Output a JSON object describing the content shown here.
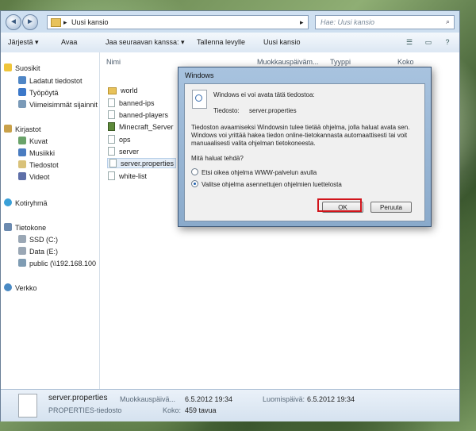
{
  "window": {
    "breadcrumb": [
      "▸",
      "Uusi kansio",
      "▸"
    ],
    "search_placeholder": "Hae: Uusi kansio",
    "toolbar": [
      "Järjestä ▾",
      "Avaa",
      "Jaa seuraavan kanssa: ▾",
      "Tallenna levylle",
      "Uusi kansio"
    ]
  },
  "nav": {
    "favorites_header": "Suosikit",
    "favorites": [
      "Ladatut tiedostot",
      "Työpöytä",
      "Viimeisimmät sijainnit"
    ],
    "libraries_header": "Kirjastot",
    "libraries": [
      "Kuvat",
      "Musiikki",
      "Tiedostot",
      "Videot"
    ],
    "homegroup": "Kotiryhmä",
    "computer_header": "Tietokone",
    "drives": [
      "SSD (C:)",
      "Data (E:)",
      "public (\\\\192.168.100"
    ],
    "network": "Verkko"
  },
  "columns": [
    "Nimi",
    "Muokkauspäiväm...",
    "Tyyppi",
    "Koko"
  ],
  "files": [
    {
      "name": "world",
      "icon": "folder-icon"
    },
    {
      "name": "banned-ips",
      "icon": "file-icon"
    },
    {
      "name": "banned-players",
      "icon": "file-icon"
    },
    {
      "name": "Minecraft_Server",
      "icon": "minecraft-icon"
    },
    {
      "name": "ops",
      "icon": "file-icon"
    },
    {
      "name": "server",
      "icon": "file-icon"
    },
    {
      "name": "server.properties",
      "icon": "file-icon"
    },
    {
      "name": "white-list",
      "icon": "file-icon"
    }
  ],
  "status": {
    "filename": "server.properties",
    "filetype": "PROPERTIES-tiedosto",
    "modified_label": "Muokkauspäivä...",
    "modified_value": "6.5.2012 19:34",
    "created_label": "Luomispäivä:",
    "created_value": "6.5.2012 19:34",
    "size_label": "Koko:",
    "size_value": "459 tavua"
  },
  "dialog": {
    "title": "Windows",
    "heading": "Windows ei voi avata tätä tiedostoa:",
    "file_label": "Tiedosto:",
    "file_value": "server.properties",
    "info_lines": [
      "Tiedoston avaamiseksi Windowsin tulee tietää ohjelma, jolla haluat avata sen.",
      "Windows voi yrittää hakea tiedon online-tietokannasta automaattisesti tai voit",
      "manuaalisesti valita ohjelman tietokoneesta."
    ],
    "question": "Mitä haluat tehdä?",
    "option_web": "Etsi oikea ohjelma WWW-palvelun avulla",
    "option_list": "Valitse ohjelma asennettujen ohjelmien luettelosta",
    "ok": "OK",
    "cancel": "Peruuta"
  }
}
